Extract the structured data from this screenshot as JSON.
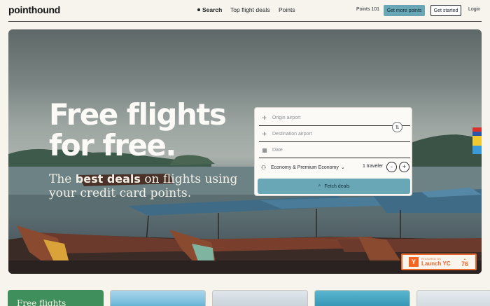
{
  "header": {
    "logo": "pointhound",
    "nav": [
      {
        "label": "Search"
      },
      {
        "label": "Top flight deals"
      },
      {
        "label": "Points"
      }
    ],
    "points101": "Points 101",
    "get_more_points": "Get more points",
    "get_started": "Get started",
    "login": "Login"
  },
  "hero": {
    "headline_line1": "Free flights",
    "headline_line2": "for free.",
    "sub_pre": "The ",
    "sub_bold": "best deals",
    "sub_post": " on flights using your credit card points."
  },
  "search": {
    "origin_placeholder": "Origin airport",
    "destination_placeholder": "Destination airport",
    "date_placeholder": "Date",
    "cabin": "Economy & Premium Economy",
    "travelers": "1 traveler",
    "minus": "-",
    "plus": "+",
    "fetch_label": "Fetch deals"
  },
  "yc_badge": {
    "small": "FEATURED ON",
    "title": "Launch YC",
    "rank_label": "▲",
    "rank": "76",
    "logo": "Y"
  },
  "bottom_cards": {
    "first_title": "Free flights"
  },
  "colors": {
    "accent": "#6aa7b6",
    "background": "#f7f4ee",
    "yc_orange": "#e8672a",
    "card_green": "#3f8f5c"
  }
}
